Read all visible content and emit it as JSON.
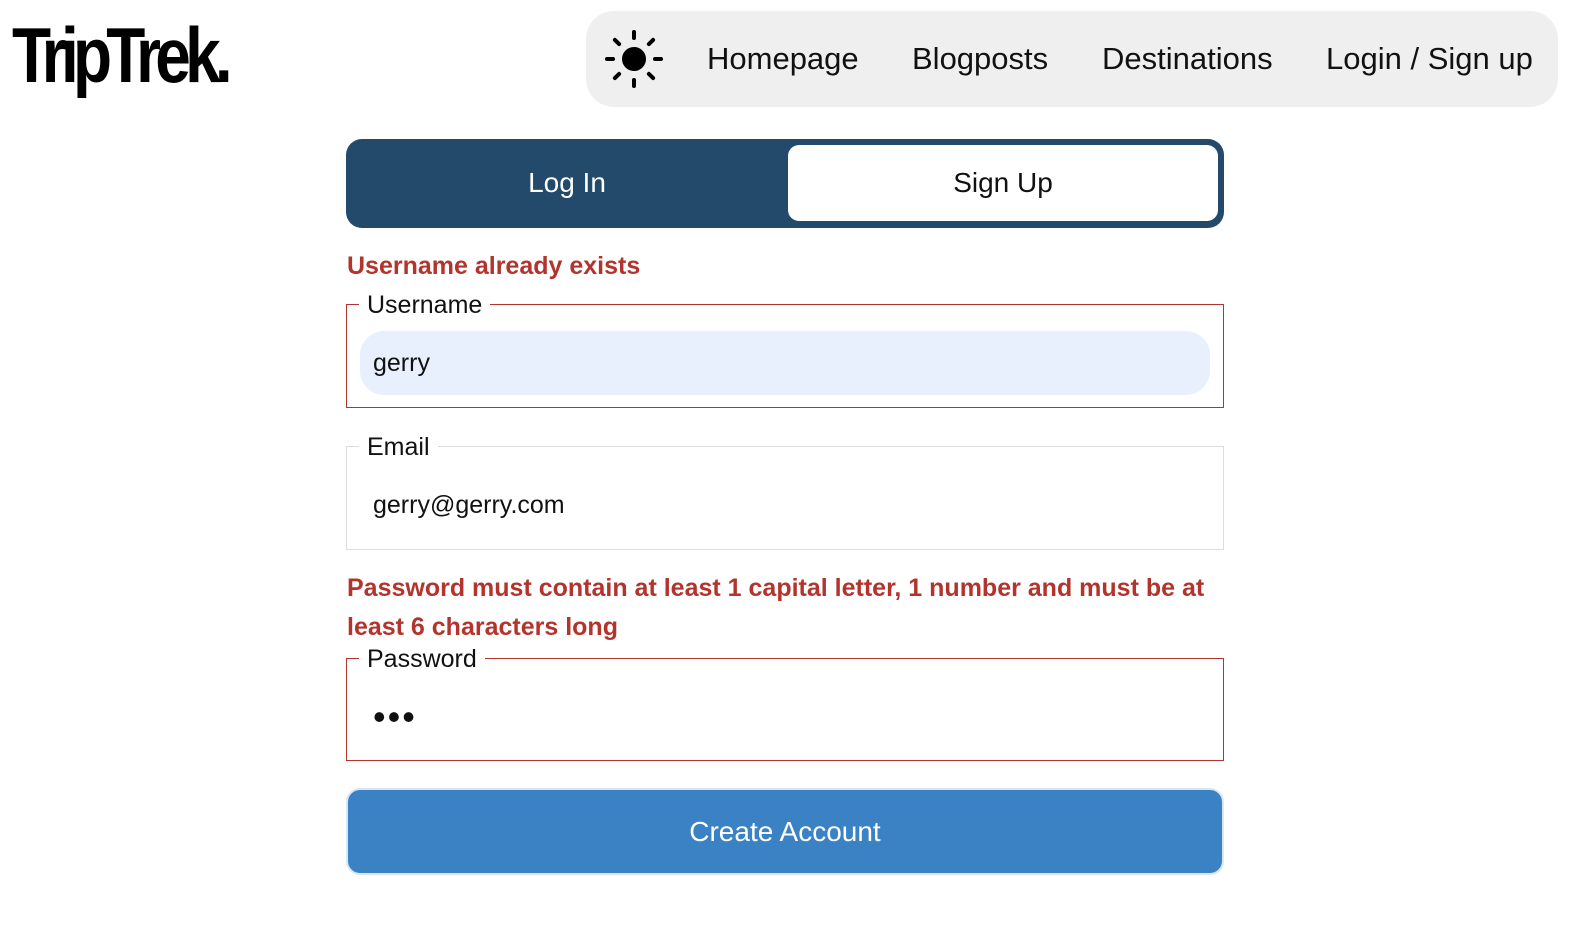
{
  "brand": {
    "logo_text": "TripTrek."
  },
  "nav": {
    "theme_icon": "sun-icon",
    "items": [
      {
        "label": "Homepage"
      },
      {
        "label": "Blogposts"
      },
      {
        "label": "Destinations"
      },
      {
        "label": "Login / Sign up"
      }
    ]
  },
  "tabs": {
    "login_label": "Log In",
    "signup_label": "Sign Up",
    "active": "Sign Up"
  },
  "form": {
    "username_error": "Username already exists",
    "username_label": "Username",
    "username_value": "gerry",
    "email_label": "Email",
    "email_value": "gerry@gerry.com",
    "password_error": "Password must contain at least 1 capital letter, 1 number and must be at least 6 characters long",
    "password_label": "Password",
    "password_mask": "•••",
    "submit_label": "Create Account"
  },
  "colors": {
    "tab_bg": "#234a6b",
    "error": "#b3342d",
    "submit_bg": "#3a82c3",
    "nav_bg": "#efefef",
    "autofill_bg": "#e8f0fe"
  }
}
